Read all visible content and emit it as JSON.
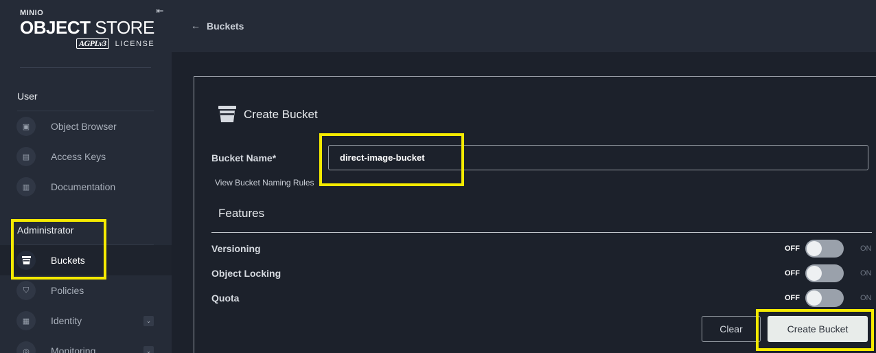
{
  "sidebar": {
    "brand_minio": "MINIO",
    "brand_product_bold": "OBJECT",
    "brand_product_light": " STORE",
    "brand_agpl": "AGPLv3",
    "brand_license": "LICENSE",
    "user_section": "User",
    "admin_section": "Administrator",
    "items": [
      {
        "label": "Object Browser",
        "icon": "object-browser-icon"
      },
      {
        "label": "Access Keys",
        "icon": "access-keys-icon"
      },
      {
        "label": "Documentation",
        "icon": "documentation-icon"
      },
      {
        "label": "Buckets",
        "icon": "bucket-icon"
      },
      {
        "label": "Policies",
        "icon": "policies-icon"
      },
      {
        "label": "Identity",
        "icon": "identity-icon"
      },
      {
        "label": "Monitoring",
        "icon": "monitoring-icon"
      }
    ]
  },
  "topbar": {
    "breadcrumb": "Buckets"
  },
  "form": {
    "title": "Create Bucket",
    "bucket_name_label": "Bucket Name*",
    "bucket_name_value": "direct-image-bucket",
    "naming_rules_link": "View Bucket Naming Rules",
    "features_title": "Features",
    "features": [
      {
        "label": "Versioning",
        "off": "OFF",
        "on": "ON",
        "enabled": false
      },
      {
        "label": "Object Locking",
        "off": "OFF",
        "on": "ON",
        "enabled": false
      },
      {
        "label": "Quota",
        "off": "OFF",
        "on": "ON",
        "enabled": false
      }
    ],
    "clear_button": "Clear",
    "create_button": "Create Bucket"
  },
  "colors": {
    "highlight": "#f5ea00",
    "sidebar_bg": "#252b37",
    "content_bg": "#1c212b",
    "brand_accent": "#c72e49"
  }
}
